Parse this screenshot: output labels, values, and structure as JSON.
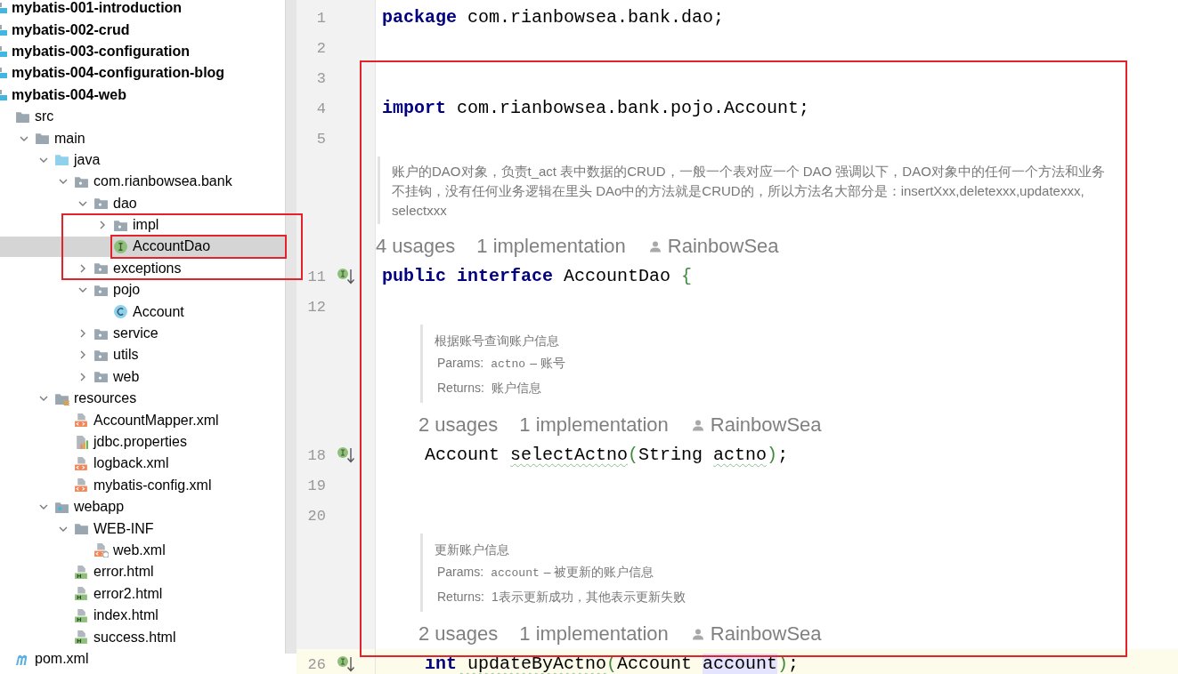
{
  "tree": [
    {
      "label": "mybatis-001-introduction",
      "kind": "module",
      "selected": false
    },
    {
      "label": "mybatis-002-crud",
      "kind": "module",
      "selected": false
    },
    {
      "label": "mybatis-003-configuration",
      "kind": "module",
      "selected": false
    },
    {
      "label": "mybatis-004-configuration-blog",
      "kind": "module",
      "selected": false
    },
    {
      "label": "mybatis-004-web",
      "kind": "module",
      "selected": false,
      "children": [
        {
          "label": "src",
          "kind": "folder",
          "selected": false,
          "children": [
            {
              "label": "main",
              "kind": "folder",
              "expanded": true,
              "selected": false,
              "children": [
                {
                  "label": "java",
                  "kind": "sourceroot",
                  "expanded": true,
                  "selected": false,
                  "children": [
                    {
                      "label": "com.rianbowsea.bank",
                      "kind": "package",
                      "expanded": true,
                      "selected": false,
                      "children": [
                        {
                          "label": "dao",
                          "kind": "package",
                          "expanded": true,
                          "selected": false,
                          "children": [
                            {
                              "label": "impl",
                              "kind": "package",
                              "expanded": false,
                              "selected": false
                            },
                            {
                              "label": "AccountDao",
                              "kind": "interface",
                              "selected": true
                            }
                          ]
                        },
                        {
                          "label": "exceptions",
                          "kind": "package",
                          "expanded": false,
                          "selected": false
                        },
                        {
                          "label": "pojo",
                          "kind": "package",
                          "expanded": true,
                          "selected": false,
                          "children": [
                            {
                              "label": "Account",
                              "kind": "class",
                              "selected": false
                            }
                          ]
                        },
                        {
                          "label": "service",
                          "kind": "package",
                          "expanded": false,
                          "selected": false
                        },
                        {
                          "label": "utils",
                          "kind": "package",
                          "expanded": false,
                          "selected": false
                        },
                        {
                          "label": "web",
                          "kind": "package",
                          "expanded": false,
                          "selected": false
                        }
                      ]
                    }
                  ]
                },
                {
                  "label": "resources",
                  "kind": "resources",
                  "expanded": true,
                  "selected": false,
                  "children": [
                    {
                      "label": "AccountMapper.xml",
                      "kind": "xml",
                      "selected": false
                    },
                    {
                      "label": "jdbc.properties",
                      "kind": "properties",
                      "selected": false
                    },
                    {
                      "label": "logback.xml",
                      "kind": "xml",
                      "selected": false
                    },
                    {
                      "label": "mybatis-config.xml",
                      "kind": "xml",
                      "selected": false
                    }
                  ]
                },
                {
                  "label": "webapp",
                  "kind": "webroot",
                  "expanded": true,
                  "selected": false,
                  "children": [
                    {
                      "label": "WEB-INF",
                      "kind": "folder",
                      "expanded": true,
                      "selected": false,
                      "children": [
                        {
                          "label": "web.xml",
                          "kind": "descriptor",
                          "selected": false
                        }
                      ]
                    },
                    {
                      "label": "error.html",
                      "kind": "html",
                      "selected": false
                    },
                    {
                      "label": "error2.html",
                      "kind": "html",
                      "selected": false
                    },
                    {
                      "label": "index.html",
                      "kind": "html",
                      "selected": false
                    },
                    {
                      "label": "success.html",
                      "kind": "html",
                      "selected": false
                    }
                  ]
                }
              ]
            }
          ]
        },
        {
          "label": "pom.xml",
          "kind": "maven",
          "selected": false
        }
      ]
    }
  ],
  "editor": [
    {
      "kind": "code",
      "number": "1",
      "current": false,
      "implemented": false,
      "tokens": [
        {
          "t": "package",
          "kind": "keyword"
        },
        {
          "t": " com.rianbowsea.bank.dao;",
          "kind": "plain"
        }
      ]
    },
    {
      "kind": "code",
      "number": "2",
      "current": false,
      "implemented": false
    },
    {
      "kind": "code",
      "number": "3",
      "current": false,
      "implemented": false
    },
    {
      "kind": "code",
      "number": "4",
      "current": false,
      "implemented": false,
      "tokens": [
        {
          "t": "import",
          "kind": "keyword"
        },
        {
          "t": " com.rianbowsea.bank.pojo.Account;",
          "kind": "plain"
        }
      ]
    },
    {
      "kind": "code",
      "number": "5",
      "current": false,
      "implemented": false
    },
    {
      "kind": "doc",
      "text": "账户的DAO对象，负责t_act 表中数据的CRUD，一般一个表对应一个 DAO 强调以下，DAO对象中的任何一个方法和业务不挂钩，没有任何业务逻辑在里头 DAo中的方法就是CRUD的，所以方法名大部分是：insertXxx,deletexxx,updatexxx, selectxxx"
    },
    {
      "kind": "inlay",
      "usages": "4 usages",
      "implementations": "1 implementation",
      "author": "RainbowSea"
    },
    {
      "kind": "code",
      "number": "11",
      "current": false,
      "implemented": true,
      "tokens": [
        {
          "t": "public interface",
          "kind": "keyword"
        },
        {
          "t": " AccountDao ",
          "kind": "plain"
        },
        {
          "t": "{",
          "kind": "brace"
        }
      ]
    },
    {
      "kind": "code",
      "number": "12",
      "current": false,
      "implemented": false
    },
    {
      "kind": "doc",
      "title": "根据账号查询账户信息",
      "params_label": "Params:",
      "param_name": "actno",
      "param_desc": "– 账号",
      "returns_label": "Returns:",
      "returns": "账户信息"
    },
    {
      "kind": "inlay",
      "usages": "2 usages",
      "implementations": "1 implementation",
      "author": "RainbowSea"
    },
    {
      "kind": "code",
      "number": "18",
      "current": false,
      "implemented": true,
      "tokens": [
        {
          "t": "    Account ",
          "kind": "plain"
        },
        {
          "t": "selectActno",
          "kind": "warning"
        },
        {
          "t": "(",
          "kind": "brace"
        },
        {
          "t": "String ",
          "kind": "plain"
        },
        {
          "t": "actno",
          "kind": "warning"
        },
        {
          "t": ")",
          "kind": "brace"
        },
        {
          "t": ";",
          "kind": "plain"
        }
      ]
    },
    {
      "kind": "code",
      "number": "19",
      "current": false,
      "implemented": false
    },
    {
      "kind": "code",
      "number": "20",
      "current": false,
      "implemented": false
    },
    {
      "kind": "doc",
      "title": "更新账户信息",
      "params_label": "Params:",
      "param_name": "account",
      "param_desc": "– 被更新的账户信息",
      "returns_label": "Returns:",
      "returns": "1表示更新成功，其他表示更新失败"
    },
    {
      "kind": "inlay",
      "usages": "2 usages",
      "implementations": "1 implementation",
      "author": "RainbowSea"
    },
    {
      "kind": "code",
      "number": "26",
      "current": true,
      "implemented": true,
      "tokens": [
        {
          "t": "    int",
          "kind": "keyword"
        },
        {
          "t": " updateByActno",
          "kind": "warning"
        },
        {
          "t": "(",
          "kind": "brace"
        },
        {
          "t": "Account ",
          "kind": "plain"
        },
        {
          "t": "account",
          "kind": "reference"
        },
        {
          "t": ")",
          "kind": "brace"
        },
        {
          "t": ";",
          "kind": "plain"
        }
      ]
    }
  ]
}
